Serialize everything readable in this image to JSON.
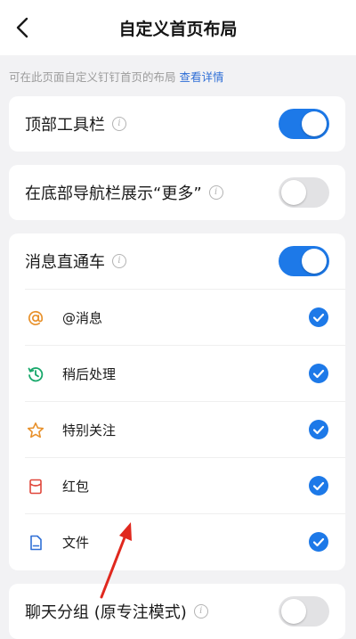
{
  "header": {
    "title": "自定义首页布局"
  },
  "hint": {
    "text": "可在此页面自定义钉钉首页的布局",
    "link": "查看详情"
  },
  "top_toolbar": {
    "label": "顶部工具栏",
    "enabled": true
  },
  "bottom_more": {
    "label": "在底部导航栏展示“更多”",
    "enabled": false
  },
  "message_bus": {
    "label": "消息直通车",
    "enabled": true,
    "items": [
      {
        "label": "@消息",
        "icon": "at-icon",
        "checked": true,
        "color": "#e8912b"
      },
      {
        "label": "稍后处理",
        "icon": "clock-icon",
        "checked": true,
        "color": "#18a86b"
      },
      {
        "label": "特别关注",
        "icon": "star-icon",
        "checked": true,
        "color": "#e8912b"
      },
      {
        "label": "红包",
        "icon": "red-envelope-icon",
        "checked": true,
        "color": "#e0473b"
      },
      {
        "label": "文件",
        "icon": "file-icon",
        "checked": true,
        "color": "#2f6fd6"
      }
    ]
  },
  "chat_group": {
    "label": "聊天分组 (原专注模式)",
    "enabled": false
  },
  "colors": {
    "accent": "#1d79e8",
    "annotation_arrow": "#e0281e"
  }
}
